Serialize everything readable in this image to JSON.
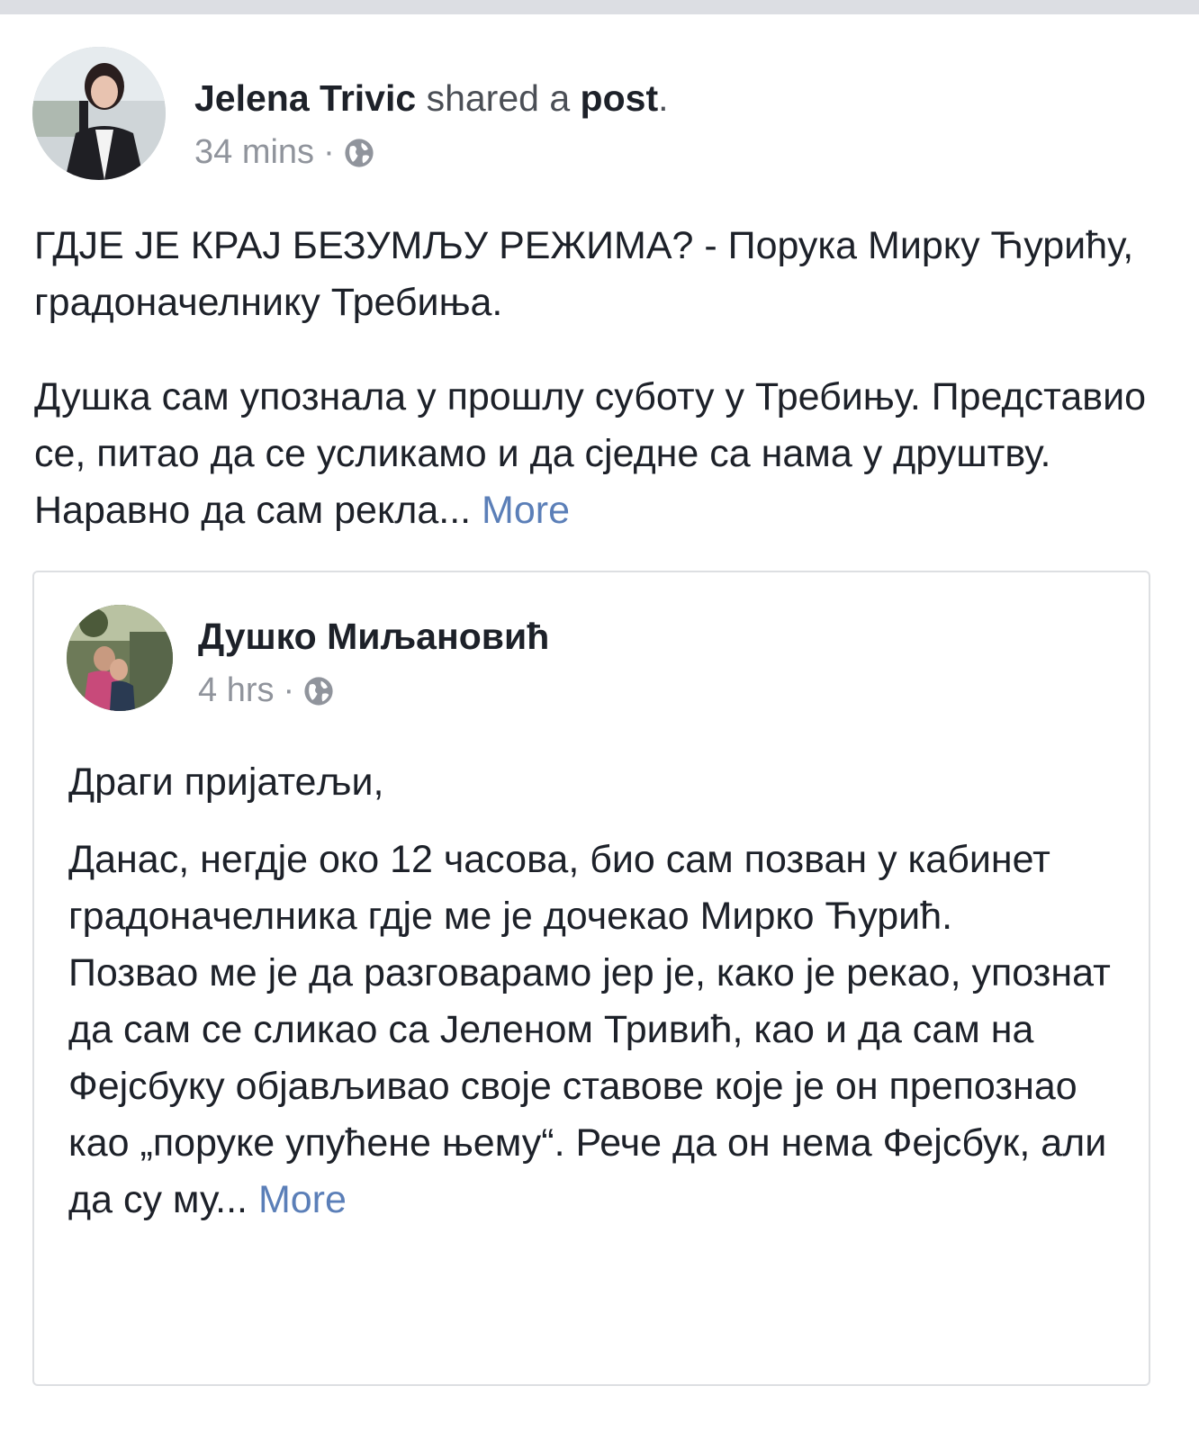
{
  "post": {
    "author_name": "Jelena Trivic",
    "action_text": "shared a",
    "post_link": "post",
    "period": ".",
    "time": "34 mins",
    "separator": "·",
    "privacy_icon": "globe-icon",
    "paragraphs": [
      "ГДЈЕ ЈЕ КРАЈ БЕЗУМЉУ РЕЖИМА? - Порука Мирку Ћурићу, градоначелнику Требиња.",
      "Душка сам упознала у прошлу суботу у Требињу. Представио се, питао да се усликамо и да сједне са нама у друштву. Наравно да сам рекла..."
    ],
    "more_label": "More"
  },
  "shared_post": {
    "author_name": "Душко Миљановић",
    "time": "4 hrs",
    "separator": "·",
    "privacy_icon": "globe-icon",
    "greeting": "Драги пријатељи,",
    "body": "Данас, негдје око 12 часова, био сам позван у кабинет градоначелника гдје ме је дочекао Мирко Ћурић.",
    "body2": "Позвао ме је да разговарамо јер је, како је рекао, упознат да сам се сликао са Јеленом Тривић, као и да сам на Фејсбуку објављивао своје ставове које је он препознао као „поруке упућене њему“. Рече да он нема Фејсбук, али да су му...",
    "more_label": "More"
  },
  "colors": {
    "link": "#5b7fb8",
    "meta": "#90949c",
    "text": "#1d2129",
    "border": "#dddfe2"
  }
}
